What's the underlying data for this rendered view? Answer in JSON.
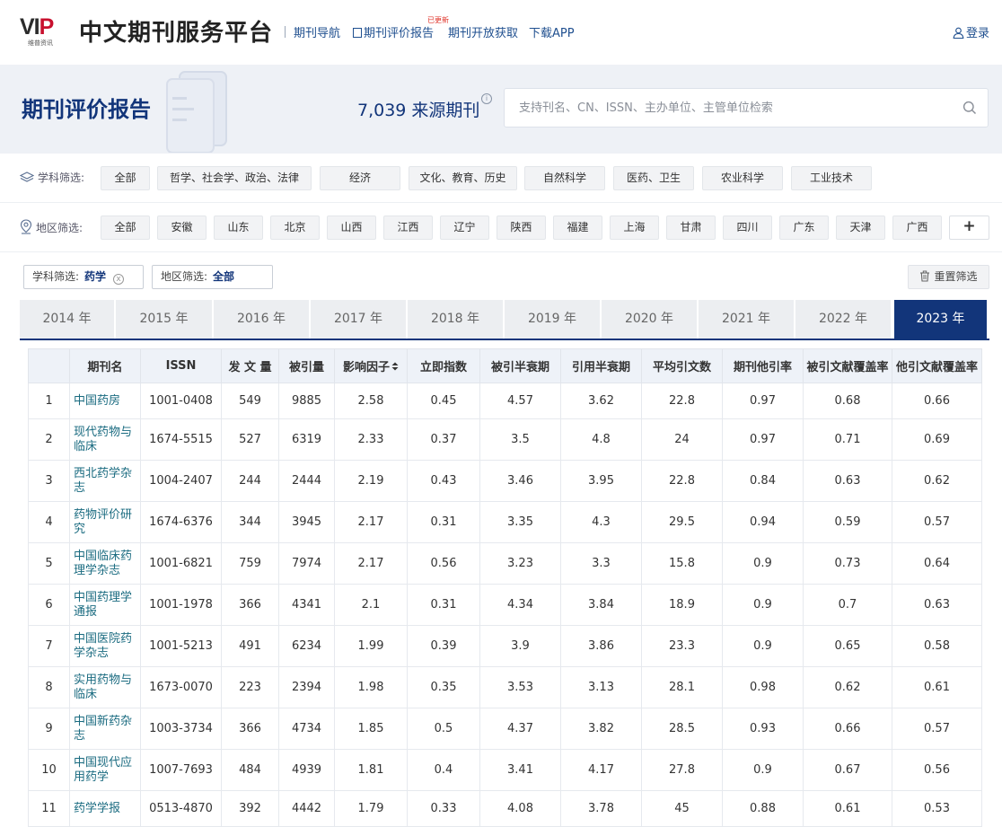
{
  "header": {
    "logo_text": "VIP",
    "logo_sub": "维普资讯",
    "site_title": "中文期刊服务平台",
    "nav": [
      {
        "label": "期刊导航"
      },
      {
        "label": "期刊评价报告"
      },
      {
        "label": "期刊开放获取"
      },
      {
        "label": "下载APP"
      }
    ],
    "badge": "已更新",
    "login": "登录"
  },
  "hero": {
    "title": "期刊评价报告",
    "source_count": "7,039 来源期刊",
    "info_icon": "i",
    "search_placeholder": "支持刊名、CN、ISSN、主办单位、主管单位检索"
  },
  "subject_filter": {
    "label": "学科筛选:",
    "options": [
      "全部",
      "哲学、社会学、政治、法律",
      "经济",
      "文化、教育、历史",
      "自然科学",
      "医药、卫生",
      "农业科学",
      "工业技术"
    ]
  },
  "region_filter": {
    "label": "地区筛选:",
    "options": [
      "全部",
      "安徽",
      "山东",
      "北京",
      "山西",
      "江西",
      "辽宁",
      "陕西",
      "福建",
      "上海",
      "甘肃",
      "四川",
      "广东",
      "天津",
      "广西"
    ],
    "more": "+"
  },
  "selected": {
    "subject_label": "学科筛选:",
    "subject_value": "药学",
    "region_label": "地区筛选:",
    "region_value": "全部",
    "clear_icon": "x",
    "reset_label": "重置筛选"
  },
  "years": [
    "2014 年",
    "2015 年",
    "2016 年",
    "2017 年",
    "2018 年",
    "2019 年",
    "2020 年",
    "2021 年",
    "2022 年",
    "2023 年"
  ],
  "active_year": "2023 年",
  "table": {
    "columns": [
      "",
      "期刊名",
      "ISSN",
      "发 文 量",
      "被引量",
      "影响因子",
      "立即指数",
      "被引半衰期",
      "引用半衰期",
      "平均引文数",
      "期刊他引率",
      "被引文献覆盖率",
      "他引文献覆盖率"
    ],
    "rows": [
      [
        "1",
        "中国药房",
        "1001-0408",
        "549",
        "9885",
        "2.58",
        "0.45",
        "4.57",
        "3.62",
        "22.8",
        "0.97",
        "0.68",
        "0.66"
      ],
      [
        "2",
        "现代药物与临床",
        "1674-5515",
        "527",
        "6319",
        "2.33",
        "0.37",
        "3.5",
        "4.8",
        "24",
        "0.97",
        "0.71",
        "0.69"
      ],
      [
        "3",
        "西北药学杂志",
        "1004-2407",
        "244",
        "2444",
        "2.19",
        "0.43",
        "3.46",
        "3.95",
        "22.8",
        "0.84",
        "0.63",
        "0.62"
      ],
      [
        "4",
        "药物评价研究",
        "1674-6376",
        "344",
        "3945",
        "2.17",
        "0.31",
        "3.35",
        "4.3",
        "29.5",
        "0.94",
        "0.59",
        "0.57"
      ],
      [
        "5",
        "中国临床药理学杂志",
        "1001-6821",
        "759",
        "7974",
        "2.17",
        "0.56",
        "3.23",
        "3.3",
        "15.8",
        "0.9",
        "0.73",
        "0.64"
      ],
      [
        "6",
        "中国药理学通报",
        "1001-1978",
        "366",
        "4341",
        "2.1",
        "0.31",
        "4.34",
        "3.84",
        "18.9",
        "0.9",
        "0.7",
        "0.63"
      ],
      [
        "7",
        "中国医院药学杂志",
        "1001-5213",
        "491",
        "6234",
        "1.99",
        "0.39",
        "3.9",
        "3.86",
        "23.3",
        "0.9",
        "0.65",
        "0.58"
      ],
      [
        "8",
        "实用药物与临床",
        "1673-0070",
        "223",
        "2394",
        "1.98",
        "0.35",
        "3.53",
        "3.13",
        "28.1",
        "0.98",
        "0.62",
        "0.61"
      ],
      [
        "9",
        "中国新药杂志",
        "1003-3734",
        "366",
        "4734",
        "1.85",
        "0.5",
        "4.37",
        "3.82",
        "28.5",
        "0.93",
        "0.66",
        "0.57"
      ],
      [
        "10",
        "中国现代应用药学",
        "1007-7693",
        "484",
        "4939",
        "1.81",
        "0.4",
        "3.41",
        "4.17",
        "27.8",
        "0.9",
        "0.67",
        "0.56"
      ],
      [
        "11",
        "药学学报",
        "0513-4870",
        "392",
        "4442",
        "1.79",
        "0.33",
        "4.08",
        "3.78",
        "45",
        "0.88",
        "0.61",
        "0.53"
      ]
    ]
  }
}
